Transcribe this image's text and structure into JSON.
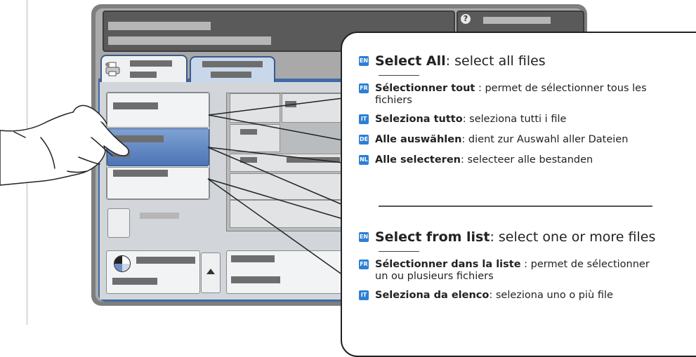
{
  "device": {
    "help_icon": "question-icon",
    "device_icon": "printer-icon",
    "color_mode_icon": "color-mode-icon",
    "scroll_up_icon": "triangle-up-icon"
  },
  "callout": {
    "select_all": {
      "en_label": "EN",
      "en_title": "Select All",
      "en_desc": ": select all files",
      "fr_label": "FR",
      "fr_title": "Sélectionner tout",
      "fr_desc": " : permet de sélectionner tous les fichiers",
      "it_label": "IT",
      "it_title": "Seleziona tutto",
      "it_desc": ": seleziona tutti i file",
      "de_label": "DE",
      "de_title": "Alle auswählen",
      "de_desc": ": dient zur Auswahl aller Dateien",
      "nl_label": "NL",
      "nl_title": "Alle selecteren",
      "nl_desc": ": selecteer alle bestanden"
    },
    "select_list": {
      "en_label": "EN",
      "en_title": "Select from list",
      "en_desc": ": select one or more files",
      "fr_label": "FR",
      "fr_title": "Sélectionner dans la liste",
      "fr_desc": " : permet de sélectionner un ou plusieurs fichiers",
      "it_label": "IT",
      "it_title": "Seleziona da elenco",
      "it_desc": ": seleziona uno o più file"
    }
  }
}
